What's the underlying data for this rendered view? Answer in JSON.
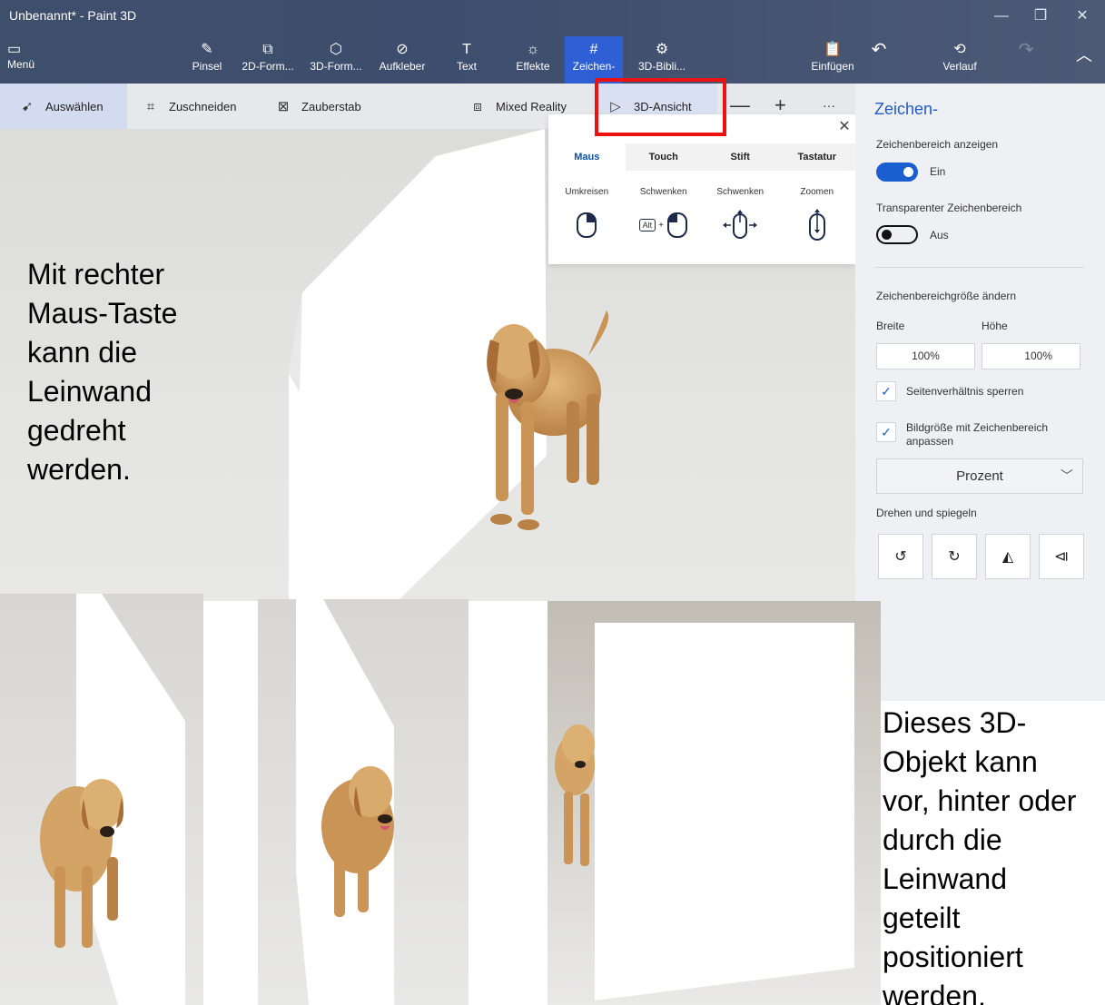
{
  "window": {
    "title": "Unbenannt* - Paint 3D"
  },
  "ribbon": {
    "menu_label": "Menü",
    "items": [
      {
        "label": "Pinsel",
        "icon": "brush-icon"
      },
      {
        "label": "2D-Form...",
        "icon": "2d-shapes-icon"
      },
      {
        "label": "3D-Form...",
        "icon": "3d-shapes-icon"
      },
      {
        "label": "Aufkleber",
        "icon": "sticker-icon"
      },
      {
        "label": "Text",
        "icon": "text-icon"
      },
      {
        "label": "Effekte",
        "icon": "effects-icon"
      },
      {
        "label": "Zeichen-",
        "icon": "canvas-icon",
        "active": true
      },
      {
        "label": "3D-Bibli...",
        "icon": "3d-library-icon"
      },
      {
        "label": "Einfügen",
        "icon": "paste-icon"
      },
      {
        "label": "Verlauf",
        "icon": "history-icon"
      }
    ],
    "undo_icon": "undo-icon",
    "redo_icon": "redo-icon",
    "collapse_icon": "chevron-up-icon"
  },
  "toolbar": {
    "select": "Auswählen",
    "crop": "Zuschneiden",
    "magic": "Zauberstab",
    "mixed_reality": "Mixed Reality",
    "view3d": "3D-Ansicht",
    "zoom_out": "—",
    "zoom_in": "+",
    "more": "···"
  },
  "popup": {
    "tabs": [
      "Maus",
      "Touch",
      "Stift",
      "Tastatur"
    ],
    "columns": [
      "Umkreisen",
      "Schwenken",
      "Schwenken",
      "Zoomen"
    ],
    "alt_key": "Alt"
  },
  "panel": {
    "heading": "Zeichen-",
    "show_canvas_label": "Zeichenbereich anzeigen",
    "show_canvas_state": "Ein",
    "transparent_label": "Transparenter Zeichenbereich",
    "transparent_state": "Aus",
    "resize_label": "Zeichenbereichgröße ändern",
    "width_label": "Breite",
    "height_label": "Höhe",
    "width_value": "100%",
    "height_value": "100%",
    "lock_ratio": "Seitenverhältnis sperren",
    "resize_image": "Bildgröße mit Zeichenbereich anpassen",
    "unit_select": "Prozent",
    "rotate_flip_label": "Drehen und spiegeln"
  },
  "captions": {
    "left": [
      "Mit rechter",
      "Maus-Taste",
      "kann die",
      "Leinwand",
      "gedreht",
      "werden."
    ],
    "right": [
      "Dieses 3D-",
      "Objekt kann",
      "vor, hinter oder",
      "durch die",
      "Leinwand",
      "geteilt",
      "positioniert",
      "werden."
    ]
  },
  "colors": {
    "ribbon": "#3e4f6c",
    "accent": "#1a5ecf",
    "highlight": "#ee1111"
  }
}
